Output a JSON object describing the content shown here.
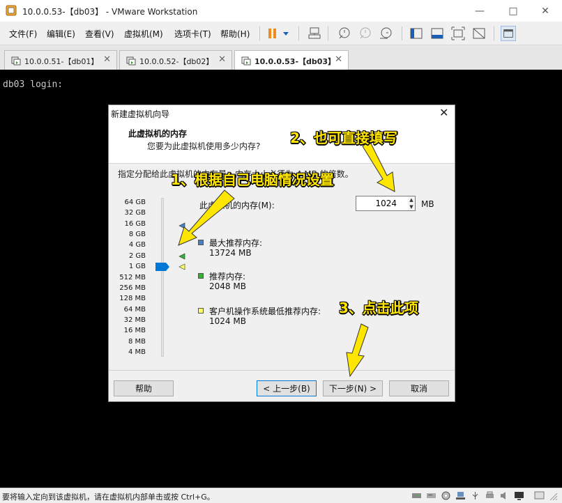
{
  "window": {
    "title": "10.0.0.53-【db03】 - VMware Workstation"
  },
  "menu": {
    "items": [
      "文件(F)",
      "编辑(E)",
      "查看(V)",
      "虚拟机(M)",
      "选项卡(T)",
      "帮助(H)"
    ]
  },
  "tabs": [
    {
      "label": "10.0.0.51-【db01】",
      "active": false
    },
    {
      "label": "10.0.0.52-【db02】",
      "active": false
    },
    {
      "label": "10.0.0.53-【db03】",
      "active": true
    }
  ],
  "console": {
    "text": "db03 login:"
  },
  "dialog": {
    "title": "新建虚拟机向导",
    "heading": "此虚拟机的内存",
    "subheading": "您要为此虚拟机使用多少内存?",
    "description": "指定分配给此虚拟机的内存量。内存大小必须为 4 MB 的倍数。",
    "scale_labels": [
      "64 GB",
      "32 GB",
      "16 GB",
      "8 GB",
      "4 GB",
      "2 GB",
      "1 GB",
      "512 MB",
      "256 MB",
      "128 MB",
      "64 MB",
      "32 MB",
      "16 MB",
      "8 MB",
      "4 MB"
    ],
    "memory_label": "此虚拟机的内存(M):",
    "memory_value": "1024",
    "memory_unit": "MB",
    "legend": [
      {
        "title": "最大推荐内存:",
        "value": "13724 MB",
        "color": "#4a7fc0"
      },
      {
        "title": "推荐内存:",
        "value": "2048 MB",
        "color": "#33b233"
      },
      {
        "title": "客户机操作系统最低推荐内存:",
        "value": "1024 MB",
        "color": "#ffff66"
      }
    ],
    "buttons": {
      "help": "帮助",
      "back": "< 上一步(B)",
      "next": "下一步(N) >",
      "cancel": "取消"
    }
  },
  "annotations": {
    "step1": "1、根据自己电脑情况设置",
    "step2": "2、也可直接填写",
    "step3": "3、点击此项"
  },
  "statusbar": {
    "text": "要将输入定向到该虚拟机，请在虚拟机内部单击或按 Ctrl+G。"
  },
  "colors": {
    "accent": "#0078d7",
    "annotation": "#ffe600"
  }
}
